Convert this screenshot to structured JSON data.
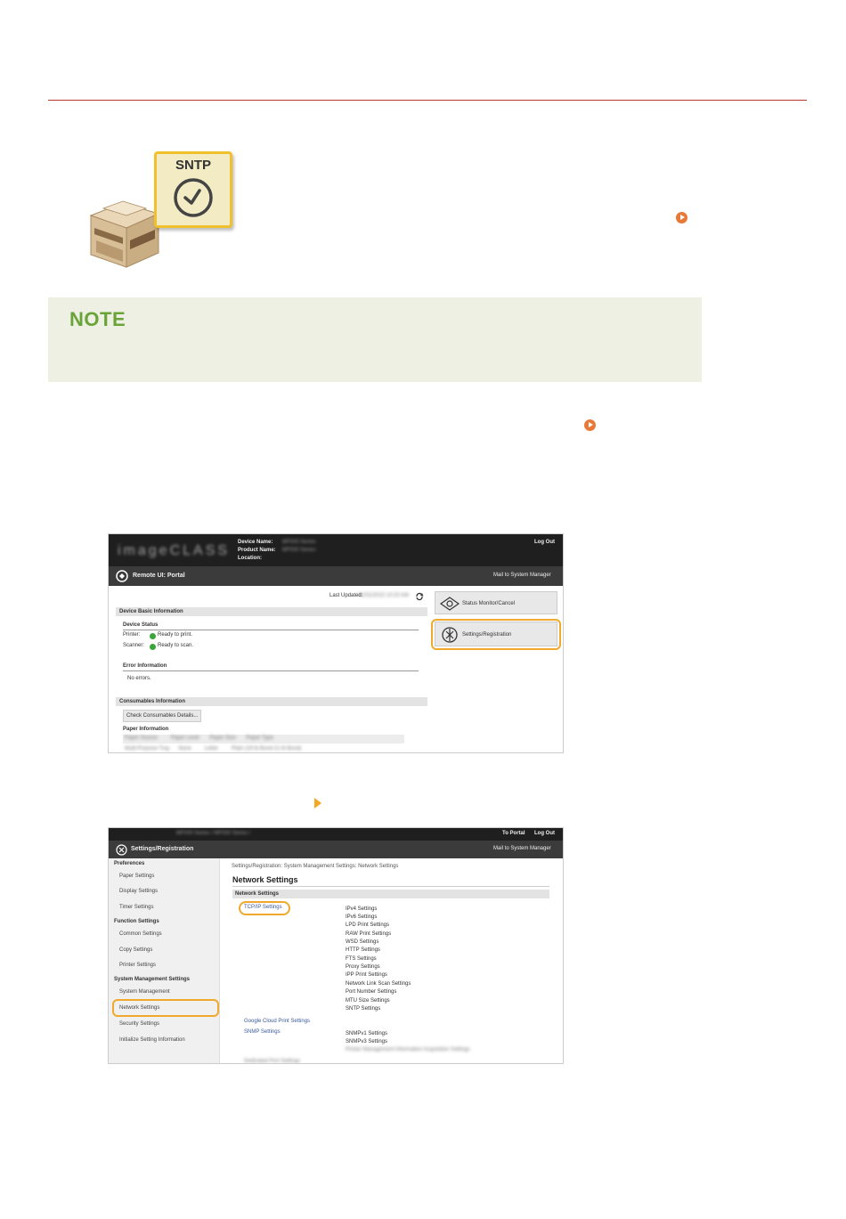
{
  "hero": {
    "badge_label": "SNTP"
  },
  "note": {
    "title": "NOTE"
  },
  "screenshot1": {
    "device_name_label": "Device Name:",
    "product_name_label": "Product Name:",
    "location_label": "Location:",
    "logout": "Log Out",
    "portal_title": "Remote UI: Portal",
    "mail_link": "Mail to System Manager",
    "last_updated": "Last Updated:",
    "device_basic_info": "Device Basic Information",
    "device_status": "Device Status",
    "printer_label": "Printer:",
    "printer_status": "Ready to print.",
    "scanner_label": "Scanner:",
    "scanner_status": "Ready to scan.",
    "error_info": "Error Information",
    "no_errors": "No errors.",
    "consumables_info": "Consumables Information",
    "check_consumables_button": "Check Consumables Details...",
    "paper_info": "Paper Information",
    "status_monitor_button": "Status Monitor/Cancel",
    "settings_registration_button": "Settings/Registration"
  },
  "screenshot2": {
    "to_portal": "To Portal",
    "logout": "Log Out",
    "header_title": "Settings/Registration",
    "mail_link": "Mail to System Manager",
    "sidebar": {
      "preferences_heading": "Preferences",
      "preferences_items": [
        "Paper Settings",
        "Display Settings",
        "Timer Settings"
      ],
      "function_heading": "Function Settings",
      "function_items": [
        "Common Settings",
        "Copy Settings",
        "Printer Settings"
      ],
      "system_heading": "System Management Settings",
      "system_items": [
        "System Management",
        "Network Settings",
        "Security Settings",
        "Initialize Setting Information"
      ]
    },
    "breadcrumb": "Settings/Registration: System Management Settings: Network Settings",
    "page_title": "Network Settings",
    "section_title": "Network Settings",
    "tcpip_link": "TCP/IP Settings",
    "tcpip_items": [
      "IPv4 Settings",
      "IPv6 Settings",
      "LPD Print Settings",
      "RAW Print Settings",
      "WSD Settings",
      "HTTP Settings",
      "FTS Settings",
      "Proxy Settings",
      "IPP Print Settings",
      "Network Link Scan Settings",
      "Port Number Settings",
      "MTU Size Settings",
      "SNTP Settings"
    ],
    "google_cloud_link": "Google Cloud Print Settings",
    "snmp_link": "SNMP Settings",
    "snmp_items": [
      "SNMPv1 Settings",
      "SNMPv3 Settings"
    ]
  }
}
